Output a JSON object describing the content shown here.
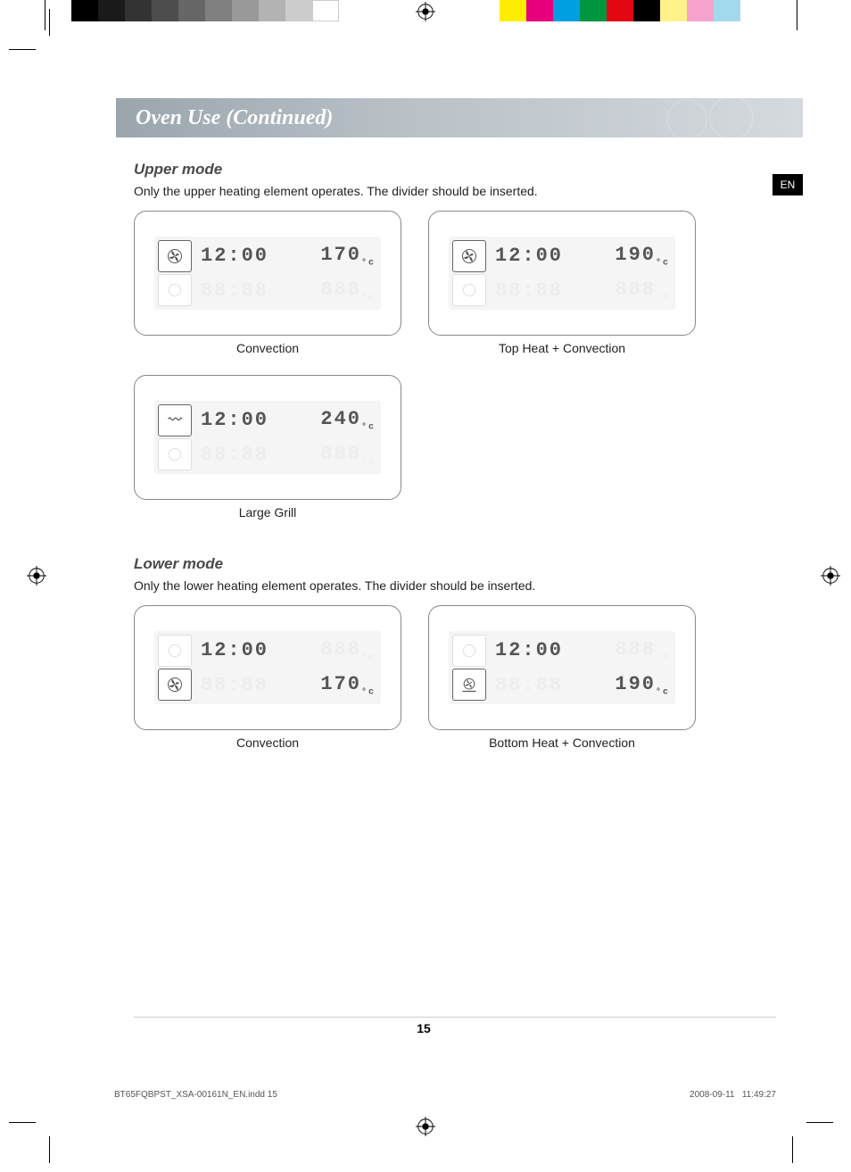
{
  "header": {
    "title": "Oven Use (Continued)",
    "lang_tab": "EN"
  },
  "upper_mode": {
    "title": "Upper mode",
    "desc": "Only the upper heating element operates. The divider should be inserted.",
    "panels": [
      {
        "label": "Convection",
        "icon_active": "fan",
        "icon_pos": "top",
        "line1_time": "12:00",
        "line1_temp": "170",
        "line1_unit": "°c",
        "line2_time": "88:88",
        "line2_temp": "888",
        "line1_active": true,
        "line2_active": false
      },
      {
        "label": "Top Heat + Convection",
        "icon_active": "fan",
        "icon_pos": "top",
        "line1_time": "12:00",
        "line1_temp": "190",
        "line1_unit": "°c",
        "line2_time": "88:88",
        "line2_temp": "888",
        "line1_active": true,
        "line2_active": false
      },
      {
        "label": "Large Grill",
        "icon_active": "grill",
        "icon_pos": "top",
        "line1_time": "12:00",
        "line1_temp": "240",
        "line1_unit": "°c",
        "line2_time": "88:88",
        "line2_temp": "888",
        "line1_active": true,
        "line2_active": false
      }
    ]
  },
  "lower_mode": {
    "title": "Lower mode",
    "desc": "Only the lower heating element operates. The divider should be inserted.",
    "panels": [
      {
        "label": "Convection",
        "icon_active": "fan",
        "icon_pos": "bottom",
        "line1_time": "12:00",
        "line1_temp": "888",
        "line1_unit": "°c",
        "line2_time": "88:88",
        "line2_temp": "170",
        "line1_time_active": true,
        "line1_temp_active": false,
        "line2_time_active": false,
        "line2_temp_active": true
      },
      {
        "label": "Bottom Heat + Convection",
        "icon_active": "fan-bottom",
        "icon_pos": "bottom",
        "line1_time": "12:00",
        "line1_temp": "888",
        "line1_unit": "°c",
        "line2_time": "88:88",
        "line2_temp": "190",
        "line1_time_active": true,
        "line1_temp_active": false,
        "line2_time_active": false,
        "line2_temp_active": true
      }
    ]
  },
  "footer": {
    "page_num": "15",
    "file": "BT65FQBPST_XSA-00161N_EN.indd   15",
    "date": "2008-09-11",
    "time": "11:49:27"
  }
}
